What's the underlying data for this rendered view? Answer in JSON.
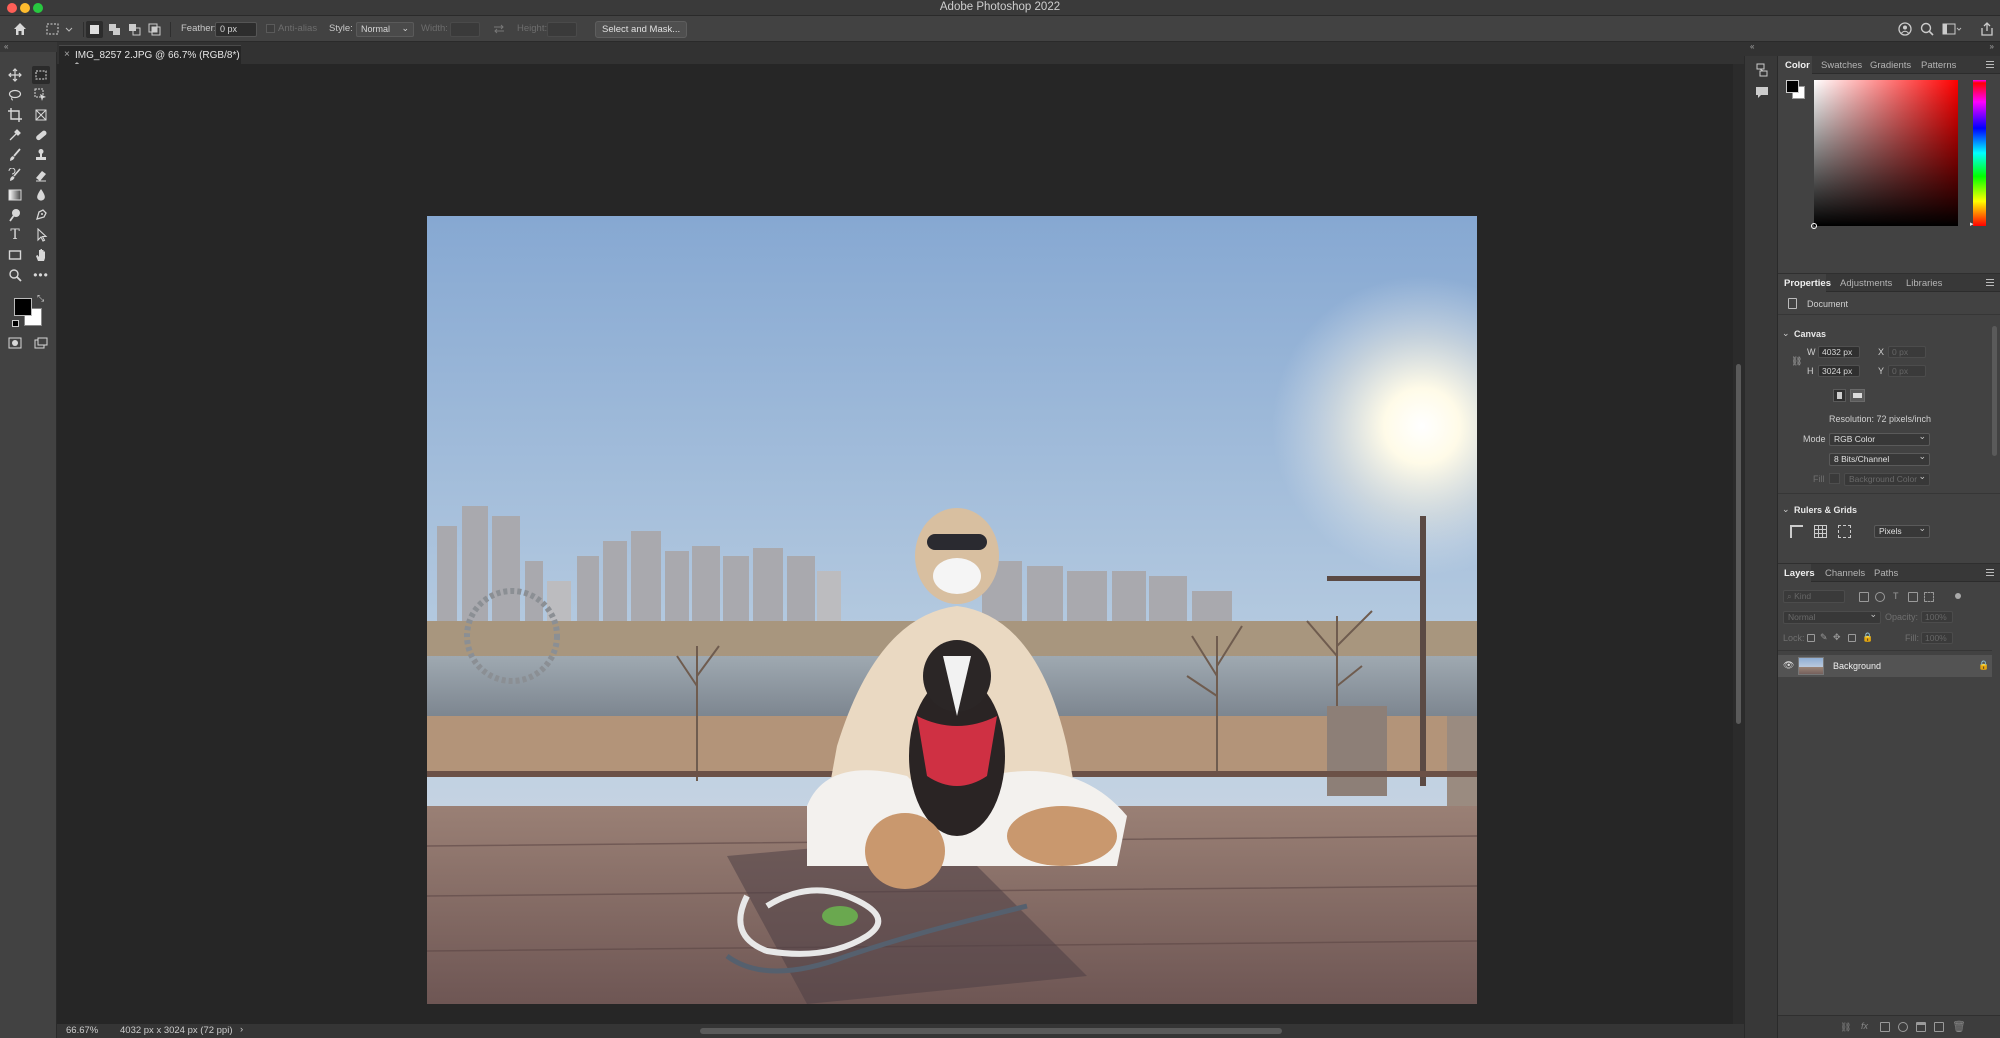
{
  "app": {
    "title": "Adobe Photoshop 2022"
  },
  "options_bar": {
    "feather_label": "Feather:",
    "feather_value": "0 px",
    "anti_alias_label": "Anti-alias",
    "style_label": "Style:",
    "style_value": "Normal",
    "width_label": "Width:",
    "height_label": "Height:",
    "select_mask_button": "Select and Mask..."
  },
  "document_tab": {
    "title": "IMG_8257 2.JPG @ 66.7% (RGB/8*) *",
    "close": "×"
  },
  "status_bar": {
    "zoom": "66.67%",
    "info": "4032 px x 3024 px (72 ppi)",
    "arrow": "›"
  },
  "color_panel": {
    "tabs": [
      "Color",
      "Swatches",
      "Gradients",
      "Patterns"
    ],
    "foreground": "#000000",
    "background": "#ffffff",
    "hue_color": "#ff0000"
  },
  "properties_panel": {
    "tabs": [
      "Properties",
      "Adjustments",
      "Libraries"
    ],
    "document_label": "Document",
    "canvas_section": "Canvas",
    "w_label": "W",
    "w_value": "4032 px",
    "h_label": "H",
    "h_value": "3024 px",
    "x_label": "X",
    "x_value": "0 px",
    "y_label": "Y",
    "y_value": "0 px",
    "resolution": "Resolution: 72 pixels/inch",
    "mode_label": "Mode",
    "mode_value": "RGB Color",
    "bits_value": "8 Bits/Channel",
    "fill_label": "Fill",
    "fill_value": "Background Color",
    "rulers_section": "Rulers & Grids",
    "units_value": "Pixels"
  },
  "layers_panel": {
    "tabs": [
      "Layers",
      "Channels",
      "Paths"
    ],
    "kind_placeholder": "Kind",
    "blend_mode": "Normal",
    "opacity_label": "Opacity:",
    "opacity_value": "100%",
    "lock_label": "Lock:",
    "fill_label": "Fill:",
    "fill_value": "100%",
    "layers": [
      {
        "name": "Background",
        "visible": true,
        "locked": true
      }
    ]
  }
}
